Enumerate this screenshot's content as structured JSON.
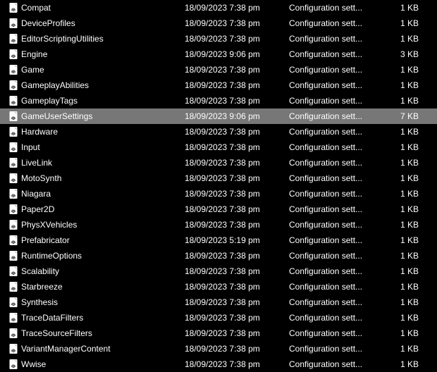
{
  "type_text": "Configuration sett...",
  "files": [
    {
      "name": "Compat",
      "date": "18/09/2023 7:38 pm",
      "size": "1 KB",
      "selected": false
    },
    {
      "name": "DeviceProfiles",
      "date": "18/09/2023 7:38 pm",
      "size": "1 KB",
      "selected": false
    },
    {
      "name": "EditorScriptingUtilities",
      "date": "18/09/2023 7:38 pm",
      "size": "1 KB",
      "selected": false
    },
    {
      "name": "Engine",
      "date": "18/09/2023 9:06 pm",
      "size": "3 KB",
      "selected": false
    },
    {
      "name": "Game",
      "date": "18/09/2023 7:38 pm",
      "size": "1 KB",
      "selected": false
    },
    {
      "name": "GameplayAbilities",
      "date": "18/09/2023 7:38 pm",
      "size": "1 KB",
      "selected": false
    },
    {
      "name": "GameplayTags",
      "date": "18/09/2023 7:38 pm",
      "size": "1 KB",
      "selected": false
    },
    {
      "name": "GameUserSettings",
      "date": "18/09/2023 9:06 pm",
      "size": "7 KB",
      "selected": true
    },
    {
      "name": "Hardware",
      "date": "18/09/2023 7:38 pm",
      "size": "1 KB",
      "selected": false
    },
    {
      "name": "Input",
      "date": "18/09/2023 7:38 pm",
      "size": "1 KB",
      "selected": false
    },
    {
      "name": "LiveLink",
      "date": "18/09/2023 7:38 pm",
      "size": "1 KB",
      "selected": false
    },
    {
      "name": "MotoSynth",
      "date": "18/09/2023 7:38 pm",
      "size": "1 KB",
      "selected": false
    },
    {
      "name": "Niagara",
      "date": "18/09/2023 7:38 pm",
      "size": "1 KB",
      "selected": false
    },
    {
      "name": "Paper2D",
      "date": "18/09/2023 7:38 pm",
      "size": "1 KB",
      "selected": false
    },
    {
      "name": "PhysXVehicles",
      "date": "18/09/2023 7:38 pm",
      "size": "1 KB",
      "selected": false
    },
    {
      "name": "Prefabricator",
      "date": "18/09/2023 5:19 pm",
      "size": "1 KB",
      "selected": false
    },
    {
      "name": "RuntimeOptions",
      "date": "18/09/2023 7:38 pm",
      "size": "1 KB",
      "selected": false
    },
    {
      "name": "Scalability",
      "date": "18/09/2023 7:38 pm",
      "size": "1 KB",
      "selected": false
    },
    {
      "name": "Starbreeze",
      "date": "18/09/2023 7:38 pm",
      "size": "1 KB",
      "selected": false
    },
    {
      "name": "Synthesis",
      "date": "18/09/2023 7:38 pm",
      "size": "1 KB",
      "selected": false
    },
    {
      "name": "TraceDataFilters",
      "date": "18/09/2023 7:38 pm",
      "size": "1 KB",
      "selected": false
    },
    {
      "name": "TraceSourceFilters",
      "date": "18/09/2023 7:38 pm",
      "size": "1 KB",
      "selected": false
    },
    {
      "name": "VariantManagerContent",
      "date": "18/09/2023 7:38 pm",
      "size": "1 KB",
      "selected": false
    },
    {
      "name": "Wwise",
      "date": "18/09/2023 7:38 pm",
      "size": "1 KB",
      "selected": false
    }
  ]
}
